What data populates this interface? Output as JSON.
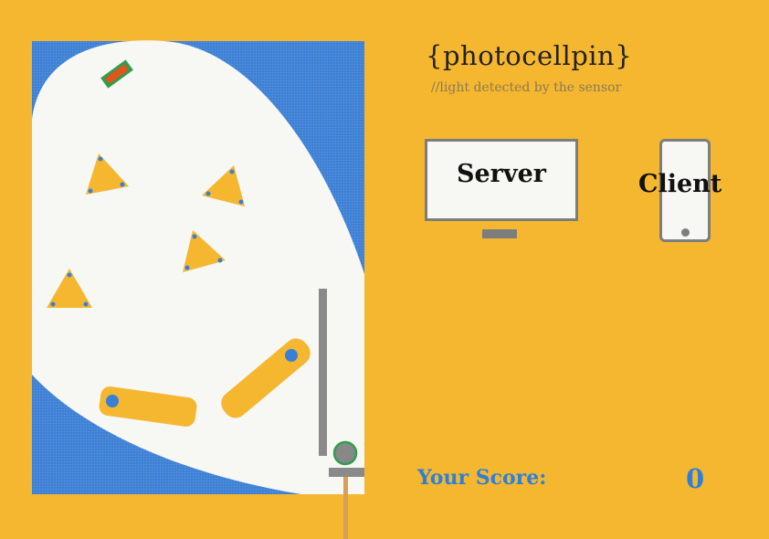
{
  "title": "{photocellpin}",
  "subtitle": "//light detected by the sensor",
  "server": {
    "label": "Server"
  },
  "client": {
    "label": "Client"
  },
  "score": {
    "label": "Your Score:",
    "value": "0"
  },
  "colors": {
    "background": "#f5b730",
    "shadow": "#3a7fd6",
    "light": "#f7f7f4",
    "obstacle": "#f5b730",
    "peg": "#3a7fd6",
    "ball": "#888888",
    "ball_ring": "#2e9e4e",
    "rail": "#8a8a8a",
    "target": "#e0541e",
    "target_border": "#2e9e4e"
  },
  "icons": [
    "monitor-icon",
    "phone-icon"
  ]
}
